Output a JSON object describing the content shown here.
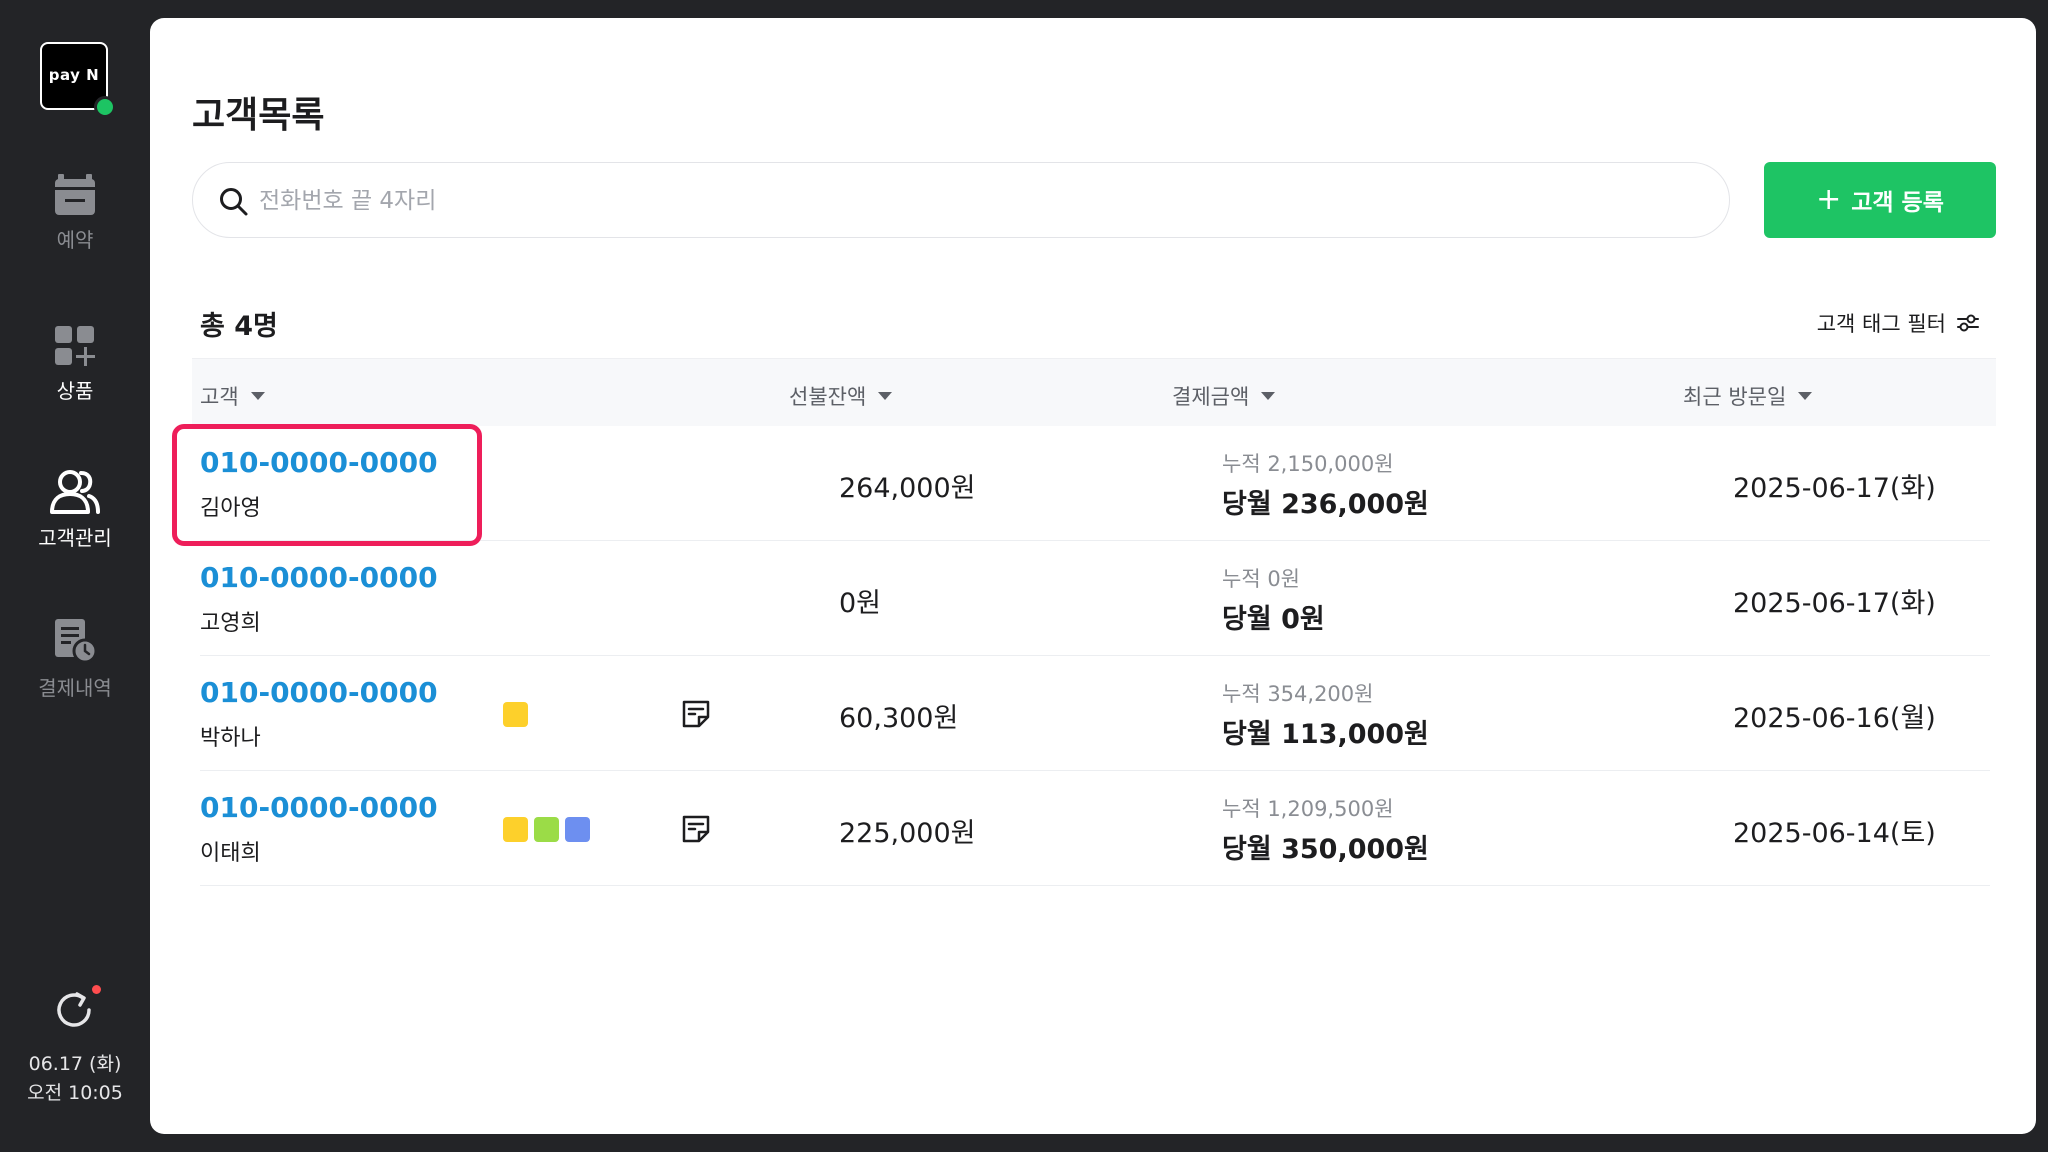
{
  "sidebar": {
    "logo_text": "pay N",
    "items": [
      {
        "label": "예약",
        "icon": "calendar-icon"
      },
      {
        "label": "상품",
        "icon": "grid-plus-icon"
      },
      {
        "label": "고객관리",
        "icon": "users-icon"
      },
      {
        "label": "결제내역",
        "icon": "receipt-clock-icon"
      }
    ],
    "date": "06.17 (화)",
    "time": "오전 10:05"
  },
  "page": {
    "title": "고객목록",
    "search_placeholder": "전화번호 끝 4자리",
    "add_button_label": "고객 등록",
    "total_label": "총 4명",
    "tag_filter_label": "고객 태그 필터"
  },
  "table": {
    "headers": {
      "customer": "고객",
      "prepaid": "선불잔액",
      "payment": "결제금액",
      "last_visit": "최근 방문일"
    },
    "rows": [
      {
        "phone": "010-0000-0000",
        "name": "김아영",
        "tags": [],
        "memo": false,
        "prepaid": "264,000원",
        "cumulative": "누적 2,150,000원",
        "monthly": "당월 236,000원",
        "last_visit": "2025-06-17(화)"
      },
      {
        "phone": "010-0000-0000",
        "name": "고영희",
        "tags": [],
        "memo": false,
        "prepaid": "0원",
        "cumulative": "누적 0원",
        "monthly": "당월 0원",
        "last_visit": "2025-06-17(화)"
      },
      {
        "phone": "010-0000-0000",
        "name": "박하나",
        "tags": [
          "#fdd02b"
        ],
        "memo": true,
        "prepaid": "60,300원",
        "cumulative": "누적 354,200원",
        "monthly": "당월 113,000원",
        "last_visit": "2025-06-16(월)"
      },
      {
        "phone": "010-0000-0000",
        "name": "이태희",
        "tags": [
          "#fdd02b",
          "#9bdc47",
          "#6d8ff0"
        ],
        "memo": true,
        "prepaid": "225,000원",
        "cumulative": "누적 1,209,500원",
        "monthly": "당월 350,000원",
        "last_visit": "2025-06-14(토)"
      }
    ]
  },
  "colors": {
    "accent_green": "#1ec464",
    "phone_blue": "#1b8fd6",
    "highlight_pink": "#ee1e5a",
    "sidebar_bg": "#232427"
  }
}
